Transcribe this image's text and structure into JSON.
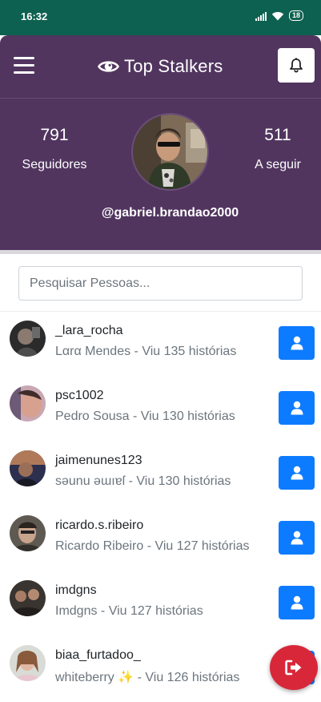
{
  "status_bar": {
    "time": "16:32",
    "battery": "18",
    "icons": [
      "signal-icon",
      "wifi-icon",
      "battery-icon"
    ],
    "color": "#0d6150"
  },
  "header": {
    "title": "Top Stalkers",
    "followers": {
      "count": "791",
      "label": "Seguidores"
    },
    "following": {
      "count": "511",
      "label": "A seguir"
    },
    "username": "@gabriel.brandao2000",
    "color": "#51355f"
  },
  "search": {
    "placeholder": "Pesquisar Pessoas...",
    "value": ""
  },
  "list": [
    {
      "username": "_lara_rocha",
      "name": "Lαrα Mendes",
      "views": "Viu 135 histórias"
    },
    {
      "username": "psc1002",
      "name": "Pedro Sousa",
      "views": "Viu 130 histórias"
    },
    {
      "username": "jaimenunes123",
      "name": "sәunu әɯıɐſ",
      "views": "Viu 130 histórias"
    },
    {
      "username": "ricardo.s.ribeiro",
      "name": "Ricardo Ribeiro",
      "views": "Viu 127 histórias"
    },
    {
      "username": "imdgns",
      "name": "Imdgns",
      "views": "Viu 127 histórias"
    },
    {
      "username": "biaa_furtadoo_",
      "name": "whiteberry ✨",
      "views": "Viu 126 histórias"
    }
  ],
  "separator": " - ",
  "colors": {
    "accent_button": "#0d7bff",
    "logout_button": "#d9273a"
  },
  "icons": {
    "menu": "hamburger-icon",
    "brand": "eye-icon",
    "notifications": "bell-icon",
    "profile_button": "user-icon",
    "logout": "logout-icon"
  }
}
